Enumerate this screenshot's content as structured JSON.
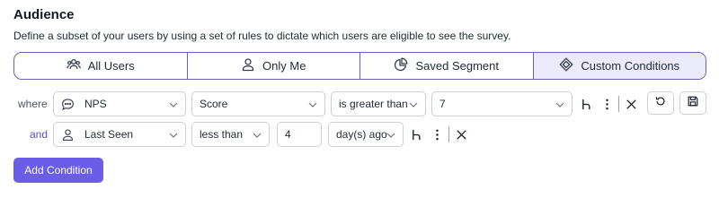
{
  "header": {
    "title": "Audience",
    "subtitle": "Define a subset of your users by using a set of rules to dictate which users are eligible to see the survey."
  },
  "segments": [
    {
      "label": "All Users",
      "icon": "users-icon"
    },
    {
      "label": "Only Me",
      "icon": "user-icon"
    },
    {
      "label": "Saved Segment",
      "icon": "pie-chart-icon"
    },
    {
      "label": "Custom Conditions",
      "icon": "diamond-icon",
      "active": true
    }
  ],
  "conditions": [
    {
      "prefix": "where",
      "attribute": "NPS",
      "attribute_icon": "chat-bubble-icon",
      "field": "Score",
      "operator": "is greater than",
      "value": "7"
    },
    {
      "prefix": "and",
      "attribute": "Last Seen",
      "attribute_icon": "user-icon",
      "operator": "less than",
      "value": "4",
      "unit": "day(s) ago"
    }
  ],
  "actions": {
    "add_condition": "Add Condition"
  },
  "colors": {
    "accent": "#6a5de8",
    "segment_border": "#6b5fb5",
    "segment_active_bg": "#ecebfb",
    "and_text": "#5a4fcf"
  }
}
